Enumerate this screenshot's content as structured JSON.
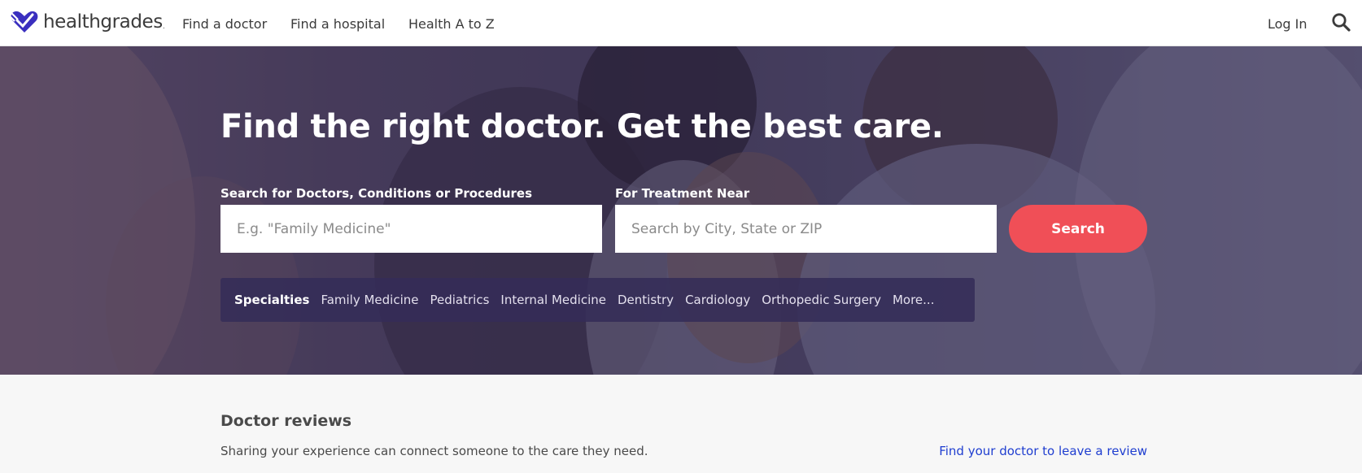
{
  "header": {
    "logo_text": "healthgrades",
    "logo_tm": ".",
    "nav": [
      {
        "label": "Find a doctor"
      },
      {
        "label": "Find a hospital"
      },
      {
        "label": "Health A to Z"
      }
    ],
    "login_label": "Log In",
    "search_icon": "search-icon"
  },
  "hero": {
    "title": "Find the right doctor. Get the best care.",
    "query_label": "Search for Doctors, Conditions or Procedures",
    "query_placeholder": "E.g. \"Family Medicine\"",
    "query_value": "",
    "location_label": "For Treatment Near",
    "location_placeholder": "Search by City, State or ZIP",
    "location_value": "",
    "search_button": "Search"
  },
  "specialties": {
    "heading": "Specialties",
    "items": [
      {
        "label": "Family Medicine"
      },
      {
        "label": "Pediatrics"
      },
      {
        "label": "Internal Medicine"
      },
      {
        "label": "Dentistry"
      },
      {
        "label": "Cardiology"
      },
      {
        "label": "Orthopedic Surgery"
      },
      {
        "label": "More..."
      }
    ]
  },
  "reviews": {
    "title": "Doctor reviews",
    "text": "Sharing your experience can connect someone to the care they need.",
    "link": "Find your doctor to leave a review"
  },
  "colors": {
    "brand": "#3a2fbf",
    "accent": "#f04f57",
    "link": "#1f3ed0",
    "text": "#4a4a4a"
  }
}
